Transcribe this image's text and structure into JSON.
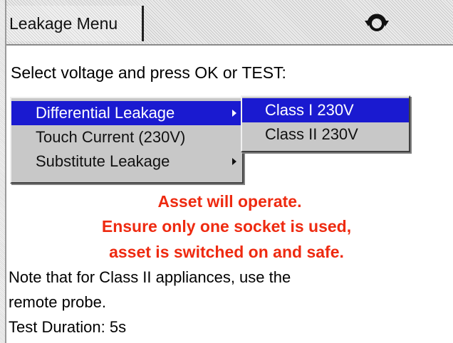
{
  "header": {
    "tab_label": "Leakage Menu",
    "action_icon": "refresh-cycle-icon"
  },
  "prompt": "Select voltage and press OK or TEST:",
  "menu": {
    "items": [
      {
        "label": "Differential Leakage",
        "selected": true,
        "has_submenu": true
      },
      {
        "label": "Touch Current (230V)",
        "selected": false,
        "has_submenu": false
      },
      {
        "label": "Substitute Leakage",
        "selected": false,
        "has_submenu": true
      }
    ],
    "submenu": [
      {
        "label": "Class I 230V",
        "selected": true
      },
      {
        "label": "Class II 230V",
        "selected": false
      }
    ]
  },
  "warning": {
    "line1": "Asset will operate.",
    "line2": "Ensure only one socket is used,",
    "line3": "asset is switched on and safe.",
    "color": "#ee2a10"
  },
  "notes": {
    "line1": "Note that for Class II appliances, use the",
    "line2": "remote probe.",
    "line3": "Test Duration: 5s"
  },
  "colors": {
    "selection": "#1a1ad0",
    "menu_bg": "#c8c8c8"
  }
}
